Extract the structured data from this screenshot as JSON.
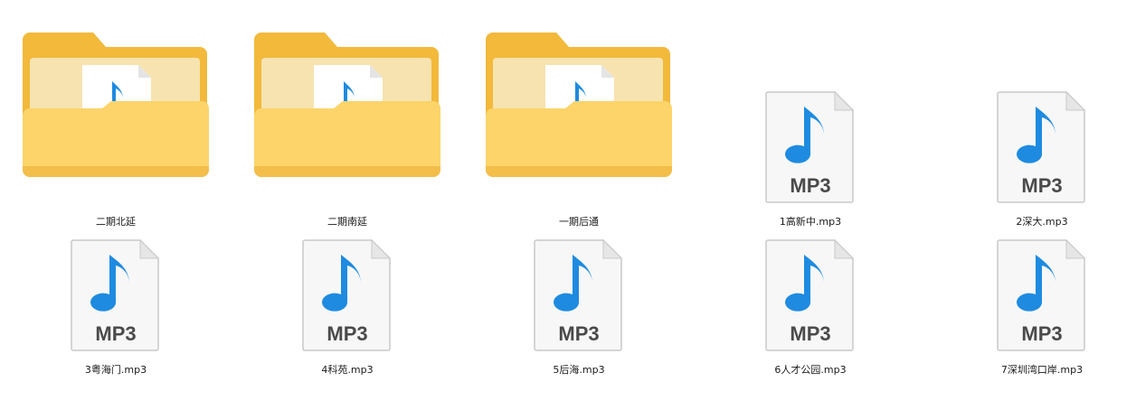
{
  "folders": [
    {
      "name": "二期北延",
      "icon": "folder-with-audio-icon"
    },
    {
      "name": "二期南延",
      "icon": "folder-with-audio-icon"
    },
    {
      "name": "一期后通",
      "icon": "folder-with-audio-icon"
    }
  ],
  "files": [
    {
      "name": "1高新中.mp3",
      "icon": "mp3-file-icon"
    },
    {
      "name": "2深大.mp3",
      "icon": "mp3-file-icon"
    },
    {
      "name": "3粤海门.mp3",
      "icon": "mp3-file-icon"
    },
    {
      "name": "4科苑.mp3",
      "icon": "mp3-file-icon"
    },
    {
      "name": "5后海.mp3",
      "icon": "mp3-file-icon"
    },
    {
      "name": "6人才公园.mp3",
      "icon": "mp3-file-icon"
    },
    {
      "name": "7深圳湾口岸.mp3",
      "icon": "mp3-file-icon"
    }
  ],
  "icon_text": {
    "mp3_badge": "MP3"
  },
  "colors": {
    "folder_back": "#F2B93B",
    "folder_front": "#FCD46A",
    "folder_inner": "#F7E3B0",
    "note_blue": "#1E8BE0",
    "page_white": "#FFFFFF",
    "page_border": "#C9C9C9",
    "badge_text": "#4A4A4A"
  }
}
